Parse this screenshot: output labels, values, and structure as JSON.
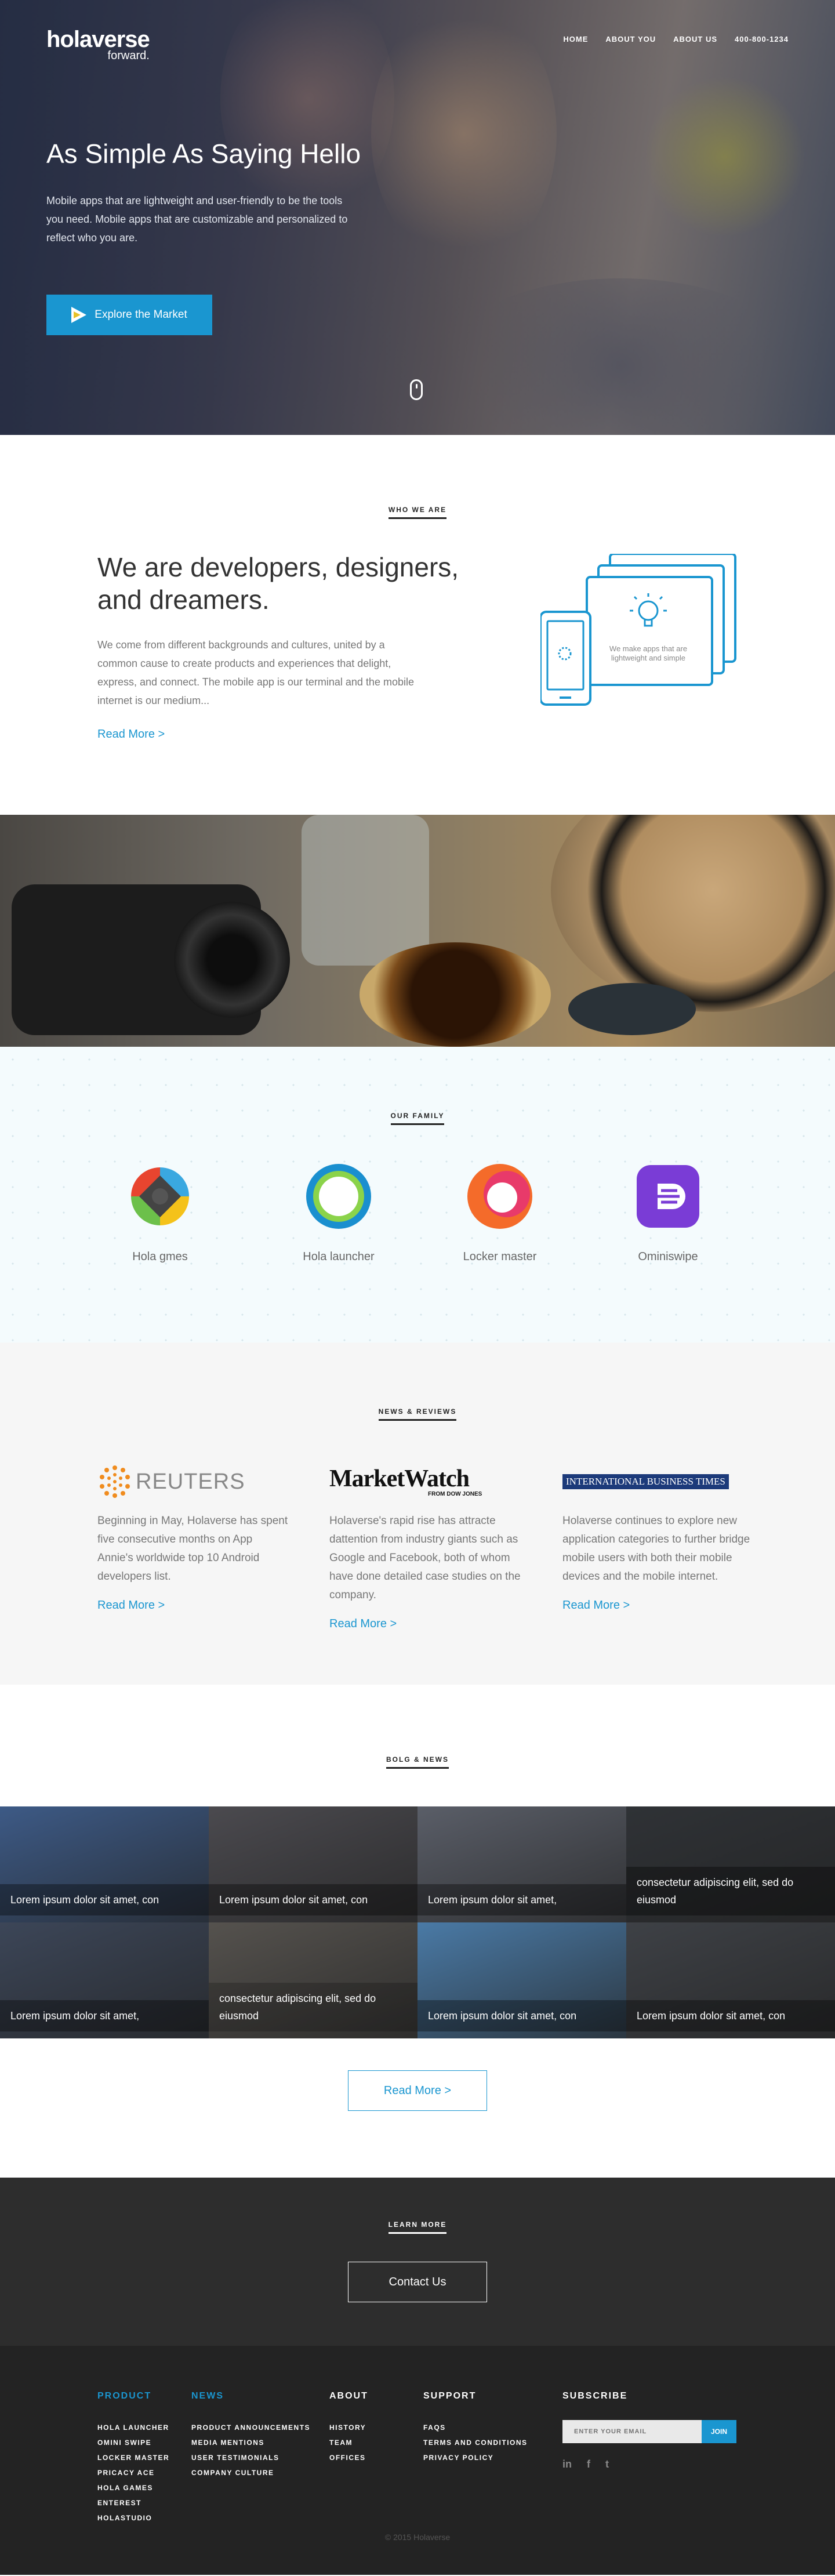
{
  "brand": {
    "name": "holaverse",
    "tagline": "forward."
  },
  "nav": [
    "HOME",
    "ABOUT YOU",
    "ABOUT US",
    "400-800-1234"
  ],
  "hero": {
    "title": "As Simple As Saying Hello",
    "lead": "Mobile apps that are lightweight and user-friendly to be the tools you need. Mobile apps that are customizable and personalized to reflect who you are.",
    "button": "Explore the Market"
  },
  "who": {
    "label": "WHO WE ARE",
    "heading": "We are developers, designers, and dreamers.",
    "body": "We come from different backgrounds and cultures, united by a common cause to create products and experiences that delight, express, and connect. The mobile app is our terminal and the mobile internet is our medium...",
    "read_more": "Read More  >",
    "illustration_text": "We make apps that are lightweight and simple"
  },
  "family": {
    "label": "OUR FAMILY",
    "apps": [
      {
        "name": "Hola gmes",
        "icon": "game-pad-icon"
      },
      {
        "name": "Hola launcher",
        "icon": "launcher-ring-icon"
      },
      {
        "name": "Locker master",
        "icon": "locker-icon"
      },
      {
        "name": "Ominiswipe",
        "icon": "swipe-icon"
      }
    ]
  },
  "news": {
    "label": "NEWS & REVIEWS",
    "items": [
      {
        "logo": "REUTERS",
        "body": "Beginning in May, Holaverse has spent five consecutive months on App Annie's worldwide top 10 Android developers list.",
        "read_more": "Read More >"
      },
      {
        "logo": "MarketWatch",
        "logo_sub": "FROM DOW JONES",
        "body": "Holaverse's rapid rise has attracte dattention from industry giants such as Google and Facebook, both of whom have done detailed case studies on the company.",
        "read_more": "Read More >"
      },
      {
        "logo": "INTERNATIONAL BUSINESS TIMES",
        "body": "Holaverse continues to explore new application categories to further bridge mobile users with both their mobile devices and the mobile internet.",
        "read_more": "Read More >"
      }
    ]
  },
  "blog": {
    "label": "BOLG & NEWS",
    "tiles": [
      {
        "caption": "Lorem ipsum dolor sit amet, con",
        "color": "#3d5a86"
      },
      {
        "caption": "Lorem ipsum dolor sit amet, con",
        "color": "#4b4a4f"
      },
      {
        "caption": "Lorem ipsum dolor sit amet,",
        "color": "#5a5e68"
      },
      {
        "caption": "consectetur adipiscing elit, sed do eiusmod",
        "color": "#2f3236"
      },
      {
        "caption": "Lorem ipsum dolor sit amet,",
        "color": "#3c4658"
      },
      {
        "caption": "consectetur adipiscing elit, sed do eiusmod",
        "color": "#55524e"
      },
      {
        "caption": "Lorem ipsum dolor sit amet, con",
        "color": "#4a7aa6"
      },
      {
        "caption": "Lorem ipsum dolor sit amet, con",
        "color": "#3e4146"
      }
    ],
    "read_more": "Read More  >"
  },
  "learn": {
    "label": "LEARN MORE",
    "button": "Contact Us"
  },
  "footer": {
    "columns": [
      {
        "title": "PRODUCT",
        "links": [
          "HOLA LAUNCHER",
          "OMINI SWIPE",
          "LOCKER MASTER",
          "PRICACY ACE",
          "HOLA GAMES",
          "ENTEREST",
          "HOLASTUDIO"
        ]
      },
      {
        "title": "NEWS",
        "links": [
          "PRODUCT ANNOUNCEMENTS",
          "MEDIA MENTIONS",
          "USER TESTIMONIALS",
          "COMPANY CULTURE"
        ]
      },
      {
        "title": "ABOUT",
        "links": [
          "HISTORY",
          "TEAM",
          "OFFICES"
        ]
      },
      {
        "title": "SUPPORT",
        "links": [
          "FAQS",
          "TERMS AND CONDITIONS",
          "PRIVACY POLICY"
        ]
      }
    ],
    "subscribe": {
      "title": "SUBSCRIBE",
      "placeholder": "ENTER YOUR EMAIL",
      "button": "JOIN"
    },
    "social": [
      "in",
      "f",
      "t"
    ],
    "copyright": "© 2015 Holaverse"
  },
  "colors": {
    "accent": "#1a96d0",
    "dark": "#2d2d2d",
    "footer": "#232323"
  }
}
